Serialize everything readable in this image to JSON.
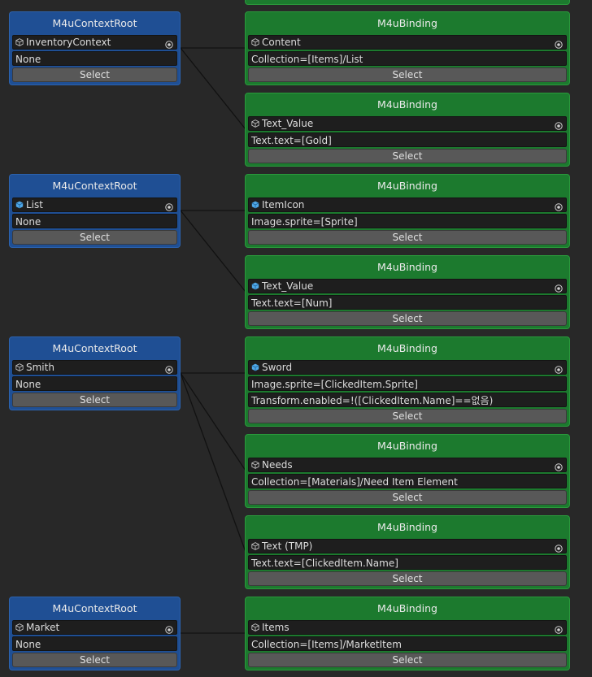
{
  "colors": {
    "background": "#282828",
    "root_node": "#1f4f94",
    "binding_node": "#1c7a2e",
    "field": "#1e1e1e",
    "button": "#585858",
    "wire": "#111111",
    "prefab_cube": "#4fa8e8",
    "gameobject_cube": "#bdbdbd"
  },
  "roots": [
    {
      "title": "M4uContextRoot",
      "object": "InventoryContext",
      "object_icon": "gameobject-cube-icon",
      "value": "None",
      "button": "Select"
    },
    {
      "title": "M4uContextRoot",
      "object": "List",
      "object_icon": "prefab-cube-icon",
      "value": "None",
      "button": "Select"
    },
    {
      "title": "M4uContextRoot",
      "object": "Smith",
      "object_icon": "gameobject-cube-icon",
      "value": "None",
      "button": "Select"
    },
    {
      "title": "M4uContextRoot",
      "object": "Market",
      "object_icon": "gameobject-cube-icon",
      "value": "None",
      "button": "Select"
    }
  ],
  "bindings": [
    {
      "title": "M4uBinding",
      "object": "Content",
      "object_icon": "gameobject-cube-icon",
      "lines": [
        "Collection=[Items]/List"
      ],
      "button": "Select"
    },
    {
      "title": "M4uBinding",
      "object": "Text_Value",
      "object_icon": "gameobject-cube-icon",
      "lines": [
        "Text.text=[Gold]"
      ],
      "button": "Select"
    },
    {
      "title": "M4uBinding",
      "object": "ItemIcon",
      "object_icon": "prefab-cube-icon",
      "lines": [
        "Image.sprite=[Sprite]"
      ],
      "button": "Select"
    },
    {
      "title": "M4uBinding",
      "object": "Text_Value",
      "object_icon": "prefab-cube-icon",
      "lines": [
        "Text.text=[Num]"
      ],
      "button": "Select"
    },
    {
      "title": "M4uBinding",
      "object": "Sword",
      "object_icon": "prefab-cube-icon",
      "lines": [
        "Image.sprite=[ClickedItem.Sprite]",
        "Transform.enabled=!([ClickedItem.Name]==없음)"
      ],
      "button": "Select"
    },
    {
      "title": "M4uBinding",
      "object": "Needs",
      "object_icon": "gameobject-cube-icon",
      "lines": [
        "Collection=[Materials]/Need Item Element"
      ],
      "button": "Select"
    },
    {
      "title": "M4uBinding",
      "object": "Text (TMP)",
      "object_icon": "gameobject-cube-icon",
      "lines": [
        "Text.text=[ClickedItem.Name]"
      ],
      "button": "Select"
    },
    {
      "title": "M4uBinding",
      "object": "Items",
      "object_icon": "gameobject-cube-icon",
      "lines": [
        "Collection=[Items]/MarketItem"
      ],
      "button": "Select"
    }
  ]
}
